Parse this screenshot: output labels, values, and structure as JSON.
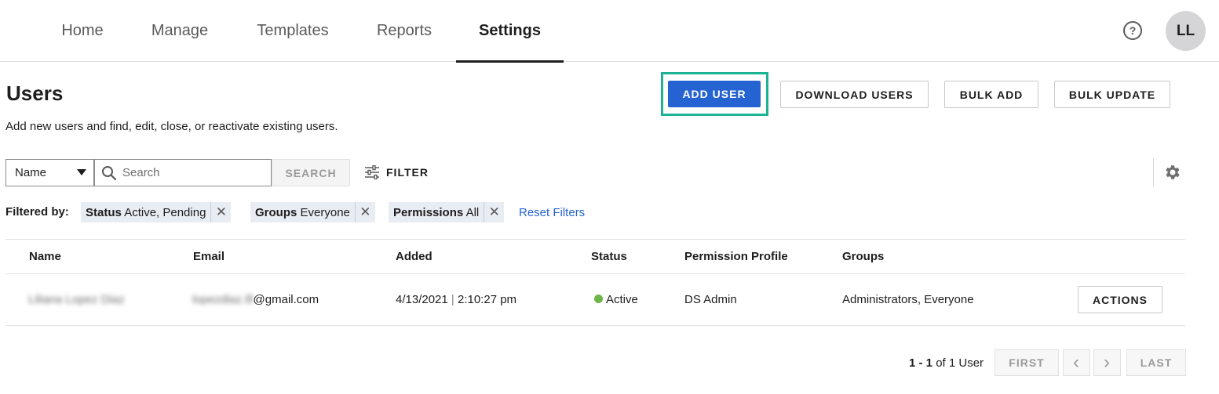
{
  "nav": {
    "tabs": [
      {
        "label": "Home"
      },
      {
        "label": "Manage"
      },
      {
        "label": "Templates"
      },
      {
        "label": "Reports"
      },
      {
        "label": "Settings",
        "active": true
      }
    ],
    "help_icon": "question-circle-icon",
    "help_glyph": "?",
    "avatar_initials": "LL"
  },
  "header": {
    "title": "Users",
    "description": "Add new users and find, edit, close, or reactivate existing users.",
    "buttons": {
      "add_user": "ADD USER",
      "download_users": "DOWNLOAD USERS",
      "bulk_add": "BULK ADD",
      "bulk_update": "BULK UPDATE"
    }
  },
  "search": {
    "field_select": "Name",
    "placeholder": "Search",
    "value": "",
    "search_button": "SEARCH",
    "filter_button": "FILTER",
    "settings_icon": "gear-icon"
  },
  "filters": {
    "label": "Filtered by:",
    "chips": [
      {
        "key": "Status",
        "value": "Active, Pending"
      },
      {
        "key": "Groups",
        "value": "Everyone"
      },
      {
        "key": "Permissions",
        "value": "All"
      }
    ],
    "remove_glyph": "✕",
    "reset_label": "Reset Filters"
  },
  "table": {
    "columns": [
      "Name",
      "Email",
      "Added",
      "Status",
      "Permission Profile",
      "Groups"
    ],
    "rows": [
      {
        "name": "Liliana Lopez Diaz",
        "email_user": "lopezdiaz.lll",
        "email_domain": "@gmail.com",
        "added_date": "4/13/2021",
        "added_sep": "|",
        "added_time": "2:10:27 pm",
        "status": "Active",
        "permission_profile": "DS Admin",
        "groups": "Administrators, Everyone",
        "actions_label": "ACTIONS"
      }
    ]
  },
  "pagination": {
    "range": "1 - 1",
    "of_text": "of 1 User",
    "first": "FIRST",
    "prev_glyph": "‹",
    "next_glyph": "›",
    "last": "LAST"
  },
  "colors": {
    "primary": "#2463d1",
    "focus_ring": "#1bb394",
    "status_active": "#6fb446",
    "chip_bg": "#e8ecf3"
  }
}
